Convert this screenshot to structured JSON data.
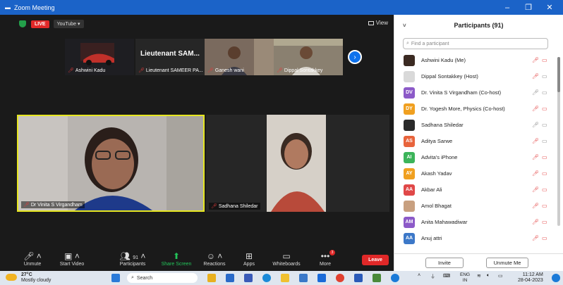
{
  "window": {
    "title": "Zoom Meeting",
    "minimize": "–",
    "maximize": "❐",
    "close": "✕"
  },
  "topbar": {
    "live": "LIVE",
    "youtube": "YouTube ▾",
    "view": "View"
  },
  "thumbnails": [
    {
      "name": "Ashwini Kadu"
    },
    {
      "name": "Lieutenant SAMEER PA...",
      "big_text": "Lieutenant SAM..."
    },
    {
      "name": "Ganesh wani"
    },
    {
      "name": "Dippal Sontakkey"
    }
  ],
  "tiles": [
    {
      "name": "Dr Vinita S Virgandham"
    },
    {
      "name": "Sadhana Shiledar"
    }
  ],
  "toolbar": {
    "unmute": "Unmute",
    "start_video": "Start Video",
    "participants": "Participants",
    "participants_count": "91",
    "share_screen": "Share Screen",
    "reactions": "Reactions",
    "apps": "Apps",
    "whiteboards": "Whiteboards",
    "more": "More",
    "more_badge": "3",
    "leave": "Leave"
  },
  "panel": {
    "title": "Participants (91)",
    "search_placeholder": "Find a participant",
    "participants": [
      {
        "name": "Ashwini Kadu (Me)",
        "initials": "",
        "color": "#3b2a22",
        "mic": "off",
        "cam": "off"
      },
      {
        "name": "Dippal Sontakkey (Host)",
        "initials": "",
        "color": "#d9d9d9",
        "mic": "off",
        "cam": "on"
      },
      {
        "name": "Dr. Vinita S Virgandham (Co-host)",
        "initials": "DV",
        "color": "#8c5ac8",
        "mic": "on",
        "cam": "on"
      },
      {
        "name": "Dr. Yogesh More, Physics (Co-host)",
        "initials": "DY",
        "color": "#f0a020",
        "mic": "off",
        "cam": "off"
      },
      {
        "name": "Sadhana Shiledar",
        "initials": "",
        "color": "#2a2a2a",
        "mic": "on",
        "cam": "on"
      },
      {
        "name": "Aditya Sarwe",
        "initials": "AS",
        "color": "#e8643c",
        "mic": "off",
        "cam": "on"
      },
      {
        "name": "Advita's iPhone",
        "initials": "AI",
        "color": "#3cb45a",
        "mic": "off",
        "cam": "off"
      },
      {
        "name": "Akash Yadav",
        "initials": "AY",
        "color": "#f0a020",
        "mic": "off",
        "cam": "off"
      },
      {
        "name": "Akbar Ali",
        "initials": "AA",
        "color": "#e04848",
        "mic": "off",
        "cam": "off"
      },
      {
        "name": "Amol Bhagat",
        "initials": "",
        "color": "#c8a080",
        "mic": "off",
        "cam": "off"
      },
      {
        "name": "Anita Mahawadiwar",
        "initials": "AM",
        "color": "#8c5ac8",
        "mic": "off",
        "cam": "off"
      },
      {
        "name": "Anuj attri",
        "initials": "AA",
        "color": "#3c78c8",
        "mic": "off",
        "cam": "off"
      }
    ],
    "invite": "Invite",
    "unmute_me": "Unmute Me"
  },
  "taskbar": {
    "temp": "27°C",
    "weather": "Mostly cloudy",
    "search": "Search",
    "lang_top": "ENG",
    "lang_bottom": "IN",
    "time": "11:12 AM",
    "date": "28-04-2023"
  }
}
